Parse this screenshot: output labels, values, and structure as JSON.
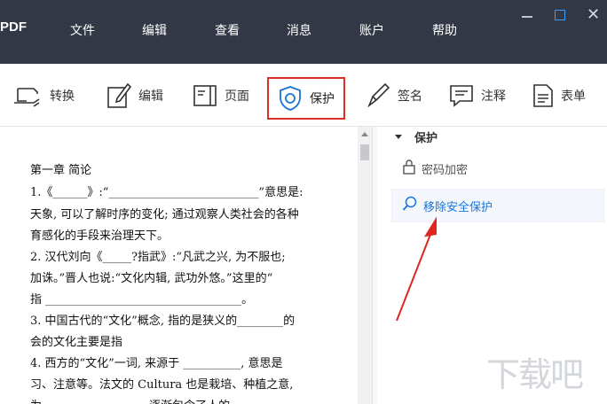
{
  "app": {
    "name": "PDF"
  },
  "menu": {
    "items": [
      "文件",
      "编辑",
      "查看",
      "消息",
      "账户",
      "帮助"
    ]
  },
  "window_controls": {
    "minimize": "minimize-icon",
    "maximize": "maximize-icon",
    "close": "✕"
  },
  "toolbar": {
    "items": [
      {
        "label": "转换",
        "icon": "convert-icon"
      },
      {
        "label": "编辑",
        "icon": "pencil-icon"
      },
      {
        "label": "页面",
        "icon": "page-icon"
      },
      {
        "label": "保护",
        "icon": "shield-icon",
        "active": true
      },
      {
        "label": "签名",
        "icon": "pen-icon"
      },
      {
        "label": "注释",
        "icon": "comment-icon"
      },
      {
        "label": "表单",
        "icon": "form-icon"
      }
    ],
    "active_border_color": "#d93025"
  },
  "document": {
    "lines": [
      "第一章 简论",
      "1.《______》:“__________________________”意思是:",
      "天象, 可以了解时序的变化; 通过观察人类社会的各种",
      "育感化的手段来治理天下。",
      "2. 汉代刘向《_____?指武》:“凡武之兴, 为不服也;",
      "加诛。”晋人也说:“文化内辑, 武功外悠。”这里的“",
      "指 __________________________________。",
      "3. 中国古代的“文化”概念, 指的是狭义的________的",
      "会的文化主要是指",
      "4. 西方的“文化”一词, 来源于 __________, 意思是",
      "习、注意等。法文的 Cultura 也是栽培、种植之意,",
      "为__________________ 逐渐包含了人的"
    ]
  },
  "panel": {
    "header": "保护",
    "items": [
      {
        "label": "密码加密",
        "icon": "lock-icon"
      },
      {
        "label": "移除安全保护",
        "icon": "search-remove-icon"
      }
    ],
    "link_color": "#1a73d9"
  },
  "annotation": {
    "arrow_color": "#e0271f"
  },
  "watermark": {
    "text": "下载吧"
  }
}
